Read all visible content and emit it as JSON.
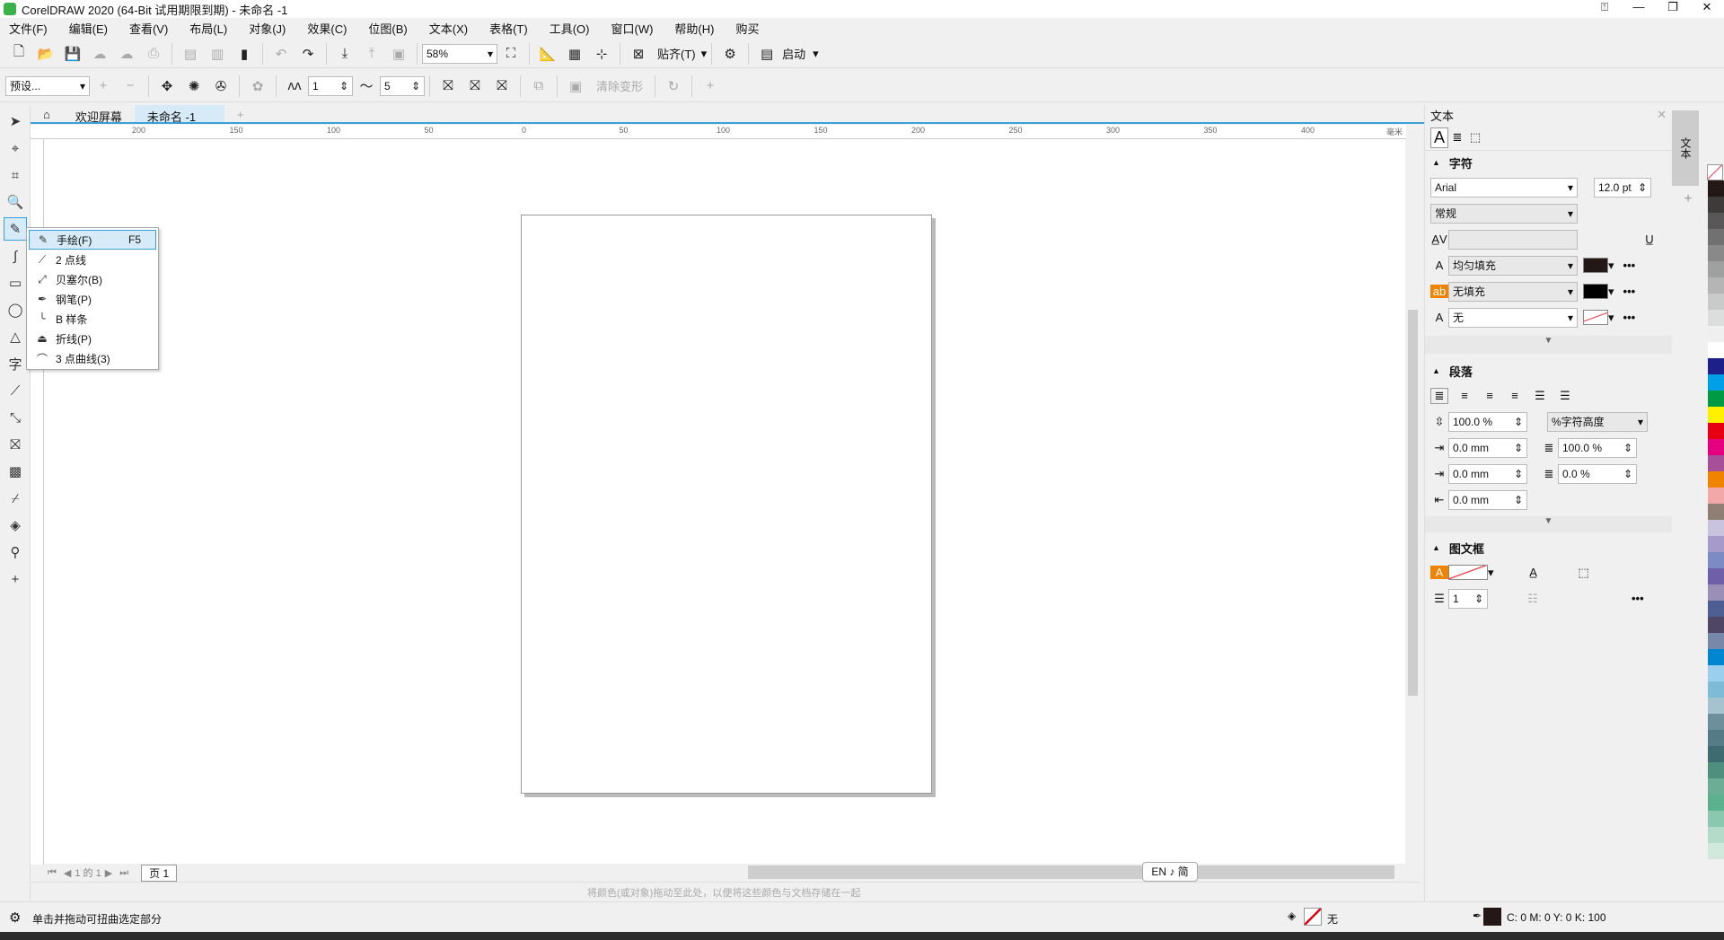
{
  "window": {
    "title": "CorelDRAW 2020 (64-Bit 试用期限到期) - 未命名 -1",
    "controls": [
      "⍐",
      "—",
      "❐",
      "✕"
    ]
  },
  "menu": [
    "文件(F)",
    "编辑(E)",
    "查看(V)",
    "布局(L)",
    "对象(J)",
    "效果(C)",
    "位图(B)",
    "文本(X)",
    "表格(T)",
    "工具(O)",
    "窗口(W)",
    "帮助(H)",
    "购买"
  ],
  "toolbar1": {
    "zoom": "58%",
    "snap": "贴齐(T)",
    "launch": "启动"
  },
  "toolbar2": {
    "preset": "预设...",
    "point_count": "1",
    "smoothness": "5",
    "clear_transform": "清除变形"
  },
  "tabs": {
    "welcome": "欢迎屏幕",
    "doc": "未命名 -1"
  },
  "ruler_ticks": [
    "200",
    "150",
    "100",
    "50",
    "0",
    "50",
    "100",
    "150",
    "200",
    "250",
    "300",
    "350",
    "400"
  ],
  "ruler_unit": "毫米",
  "flyout": {
    "items": [
      {
        "label": "手绘(F)",
        "shortcut": "F5",
        "icon": "freehand-icon"
      },
      {
        "label": "2 点线",
        "icon": "two-point-line-icon"
      },
      {
        "label": "贝塞尔(B)",
        "icon": "bezier-icon"
      },
      {
        "label": "钢笔(P)",
        "icon": "pen-icon"
      },
      {
        "label": "B 样条",
        "icon": "bspline-icon"
      },
      {
        "label": "折线(P)",
        "icon": "polyline-icon"
      },
      {
        "label": "3 点曲线(3)",
        "icon": "three-point-curve-icon"
      }
    ]
  },
  "pagenav": {
    "count": "1 的 1",
    "page_tab": "页 1"
  },
  "ime": "EN ♪ 简",
  "palette_hint": "将颜色(或对象)拖动至此处，以便将这些颜色与文档存储在一起",
  "status": {
    "hint": "单击并拖动可扭曲选定部分",
    "fill": "无",
    "outline": "C: 0 M: 0 Y: 0 K: 100"
  },
  "docker": {
    "title": "文本",
    "character": {
      "title": "字符",
      "font": "Arial",
      "size": "12.0 pt",
      "style": "常规",
      "fill_type": "均匀填充",
      "bg_fill": "无填充",
      "outline": "无"
    },
    "paragraph": {
      "title": "段落",
      "line_spacing": "100.0 %",
      "line_unit": "%字符高度",
      "indent_first": "0.0 mm",
      "char_spacing": "100.0 %",
      "indent_left": "0.0 mm",
      "word_spacing": "0.0 %",
      "indent_right": "0.0 mm"
    },
    "frame": {
      "title": "图文框",
      "columns": "1"
    }
  },
  "side_tab": "文本",
  "colors": {
    "accent": "#3aa0d8",
    "text_fill": "#231815"
  },
  "palette": [
    "#231815",
    "#3e3a39",
    "#595757",
    "#727171",
    "#898989",
    "#9fa0a0",
    "#b5b5b6",
    "#c9caca",
    "#dcdddd",
    "#efefef",
    "#ffffff",
    "#1d2088",
    "#00a0e9",
    "#009944",
    "#fff100",
    "#e60012",
    "#e4007f",
    "#a84f9a",
    "#f08300",
    "#f2a8a8",
    "#8f7e74",
    "#c9c3e0",
    "#a59aca",
    "#7d8bc4",
    "#6f5fa8",
    "#9b8fb7",
    "#4e5e92",
    "#4e4664",
    "#7788a8",
    "#0086d1",
    "#9bcfee",
    "#7ebbd6",
    "#a4c3cf",
    "#6d8f9c",
    "#557b86",
    "#3d6b6f",
    "#4f8f7d",
    "#6cae95",
    "#5bb08e",
    "#8ac8b0",
    "#b4dac9",
    "#d0e9dc"
  ]
}
